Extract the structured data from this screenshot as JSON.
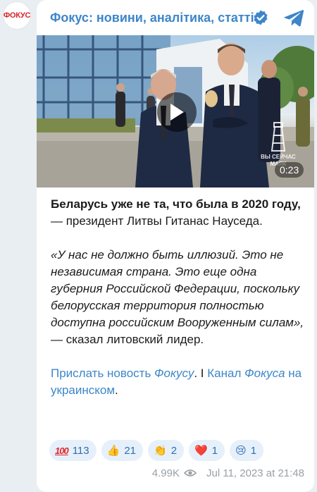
{
  "avatar": {
    "text": "ФОКУС"
  },
  "header": {
    "channel_name": "Фокус: новини, аналітика, статті",
    "verified_icon": "verified-check-icon",
    "share_icon": "telegram-plane-icon"
  },
  "video": {
    "duration": "0:23",
    "watermark": "ВЫ СЕЙЧАС МАЯК",
    "play_icon": "play-icon"
  },
  "message": {
    "lead_bold": "Беларусь уже не та, что была в 2020 году,",
    "lead_rest": " — президент Литвы Гитанас Науседа.",
    "quote_italic": "«У нас не должно быть иллюзий. Это не независимая страна. Это еще одна губерния Российской Федерации, поскольку белорусская территория полностью доступна российским Вооруженным силам»,",
    "quote_rest": " — сказал литовский лидер.",
    "link1_pre": "Прислать новость ",
    "link1_italic": "Фокусу",
    "separator": ". I ",
    "link2_pre": "Канал ",
    "link2_italic": "Фокуса",
    "link2_post": " на украинском",
    "end": "."
  },
  "reactions": [
    {
      "emoji": "💯",
      "count": "113"
    },
    {
      "emoji": "👍",
      "count": "21"
    },
    {
      "emoji": "👏",
      "count": "2"
    },
    {
      "emoji": "❤️",
      "count": "1"
    },
    {
      "emoji": "😢",
      "count": "1"
    }
  ],
  "footer": {
    "views": "4.99K",
    "timestamp": "Jul 11, 2023 at 21:48"
  },
  "colors": {
    "accent": "#3d86c9",
    "brand_red": "#d8232a",
    "background": "#e9eef2"
  }
}
